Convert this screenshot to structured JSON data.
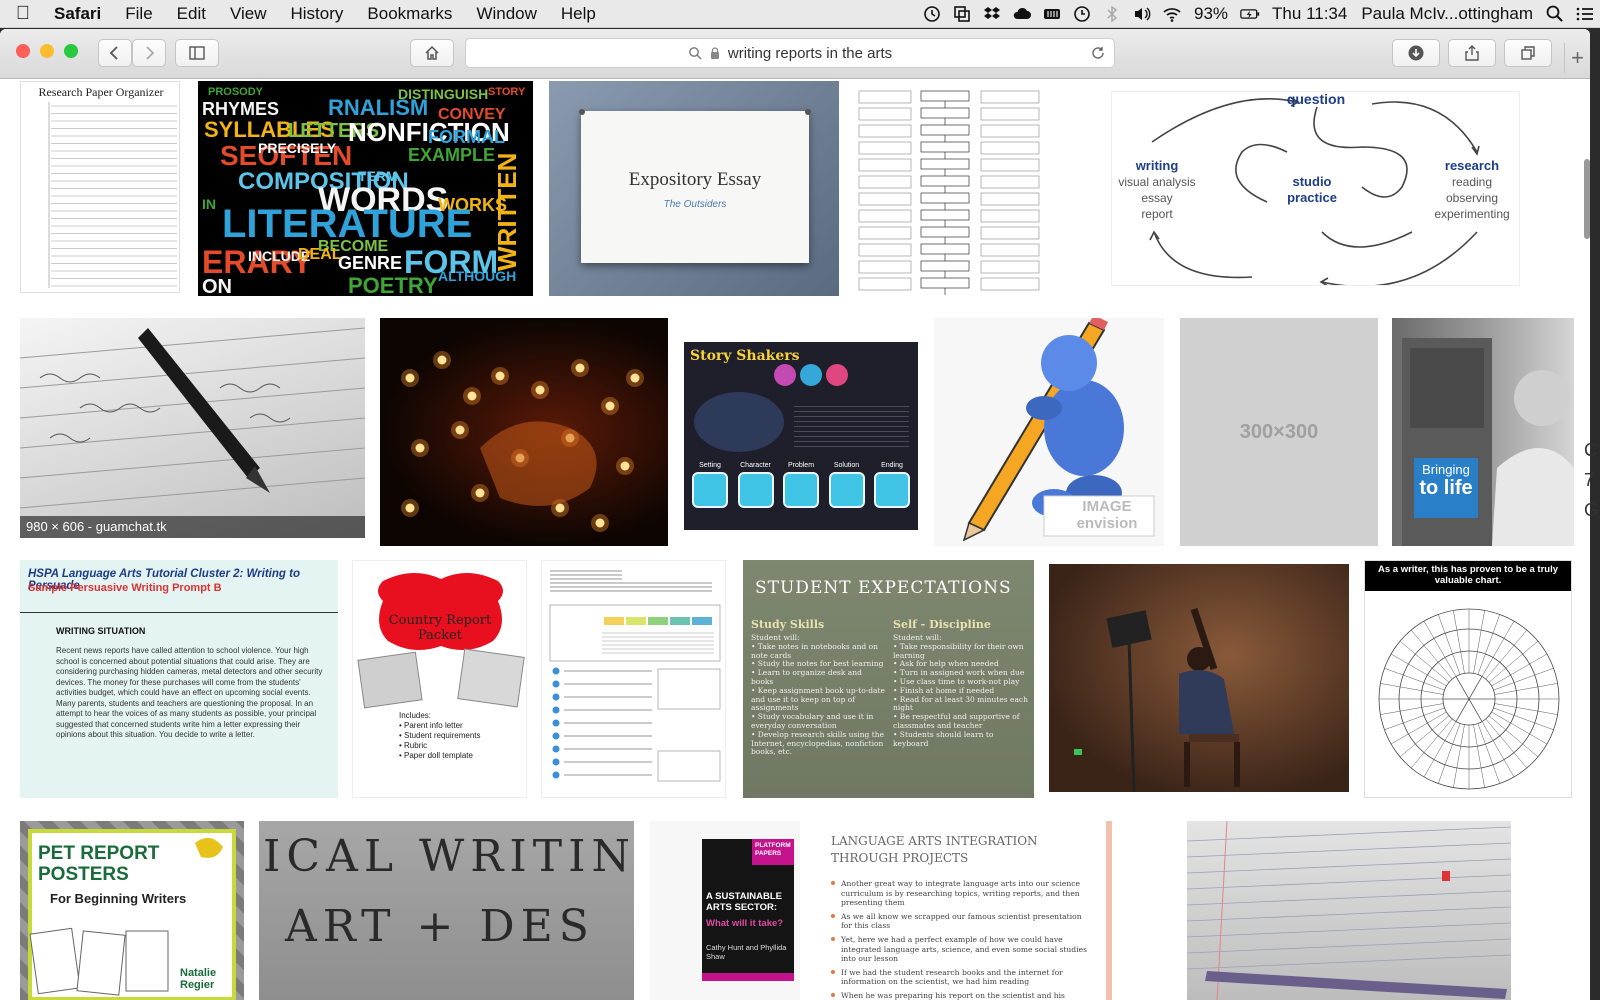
{
  "menubar": {
    "app_name": "Safari",
    "menus": [
      "File",
      "Edit",
      "View",
      "History",
      "Bookmarks",
      "Window",
      "Help"
    ],
    "battery": "93%",
    "clock": "Thu 11:34",
    "user": "Paula McIv...ottingham"
  },
  "toolbar": {
    "address_text": "writing reports in the arts"
  },
  "results": {
    "t1_title": "Research Paper Organizer",
    "t2_words": [
      "PROSODY",
      "RHYMES",
      "SYLLABLES",
      "RNALISM",
      "SEOFTEN",
      "LETTERS",
      "NONFICTION",
      "COMPOSITION",
      "EXAMPLE",
      "WORDS",
      "WORKS",
      "LITERATURE",
      "ERARY",
      "BECOME",
      "GENRE",
      "FORM",
      "POETRY",
      "ON",
      "WRITTEN",
      "FORMAL",
      "CONVEY",
      "DISTINGUISH",
      "PRECISELY",
      "TERM",
      "IN",
      "INCLUDE",
      "DEAL",
      "ALTHOUGH",
      "STORY"
    ],
    "t3_title": "Expository Essay",
    "t3_subtitle": "The Outsiders",
    "t5_question": "question",
    "t5_writing": "writing",
    "t5_writing_sub": [
      "visual analysis",
      "essay",
      "report"
    ],
    "t5_studio": [
      "studio",
      "practice"
    ],
    "t5_research": "research",
    "t5_research_sub": [
      "reading",
      "observing",
      "experimenting"
    ],
    "t6_caption": "980 × 606 - guamchat.tk",
    "t8_brand": "Story Shakers",
    "t8_labels": [
      "Setting",
      "Character",
      "Problem",
      "Solution",
      "Ending"
    ],
    "t9_watermark": "IMAGE envision",
    "t10_placeholder": "300×300",
    "t11_line1": "Bringing",
    "t11_line2": "to life",
    "t12_title": "HSPA Language Arts Tutorial Cluster 2: Writing to Persuade",
    "t12_subtitle": "Sample Persuasive Writing Prompt B",
    "t12_heading": "WRITING SITUATION",
    "t12_body": "Recent news reports have called attention to school violence. Your high school is concerned about potential situations that could arise. They are considering purchasing hidden cameras, metal detectors and other security devices. The money for these purchases will come from the students' activities budget, which could have an effect on upcoming social events. Many parents, students and teachers are questioning the proposal. In an attempt to hear the voices of as many students as possible, your principal suggested that concerned students write him a letter expressing their opinions about this situation. You decide to write a letter.",
    "t13_title": "Country Report Packet",
    "t13_includes": [
      "Includes:",
      "• Parent info letter",
      "• Student requirements",
      "• Rubric",
      "• Paper doll template"
    ],
    "t15_title": "STUDENT EXPECTATIONS",
    "t15_col1_head": "Study Skills",
    "t15_col2_head": "Self - Discipline",
    "t15_col1": [
      "Student will:",
      "Take notes in notebooks and on note cards",
      "Study the notes for best learning",
      "Learn to organize desk and books",
      "Keep assignment book up-to-date and use it to keep on top of assignments",
      "Study vocabulary and use it in everyday conversation",
      "Develop research skills using the Internet, encyclopedias, nonfiction books, etc."
    ],
    "t15_col2": [
      "Student will:",
      "Take responsibility for their own learning",
      "Ask for help when needed",
      "Turn in assigned work when due",
      "Use class time to work-not play",
      "Finish at home if needed",
      "Read for at least 30 minutes each night",
      "Be respectful and supportive of classmates and teacher",
      "Students should learn to keyboard"
    ],
    "t17_header": "As a writer, this has proven to be a truly valuable chart.",
    "t18_title": "PET REPORT POSTERS",
    "t18_sub": "For Beginning Writers",
    "t18_author": "Natalie Regier",
    "t19_text1": "ICAL WRITIN",
    "t19_text2": "ART + DES",
    "t20_series": "PLATFORM PAPERS",
    "t20_title": "A SUSTAINABLE ARTS SECTOR:",
    "t20_sub": "What will it take?",
    "t20_authors": "Cathy Hunt and Phyllida Shaw",
    "t21_title": "LANGUAGE ARTS INTEGRATION THROUGH PROJECTS",
    "t21_bullets": [
      "Another great way to integrate language arts into our science curriculum is by researching topics, writing reports, and then presenting them",
      "As we all know we scrapped our famous scientist presentation for this class",
      "Yet, here we had a perfect example of how we could have integrated language arts, science, and even some social studies into our lesson",
      "If we had the student research books and the internet for information on the scientist, we had him reading",
      "When he was preparing his report on the scientist and his speech to give in class, we had him writing"
    ],
    "edge_chars": [
      "C",
      "7",
      "G"
    ]
  },
  "colors": {
    "window_bg": "#ffffff",
    "toolbar_bg": "#dcdcdc",
    "close": "#fc5f57",
    "minimize": "#fdbc2e",
    "zoom": "#28c840"
  }
}
